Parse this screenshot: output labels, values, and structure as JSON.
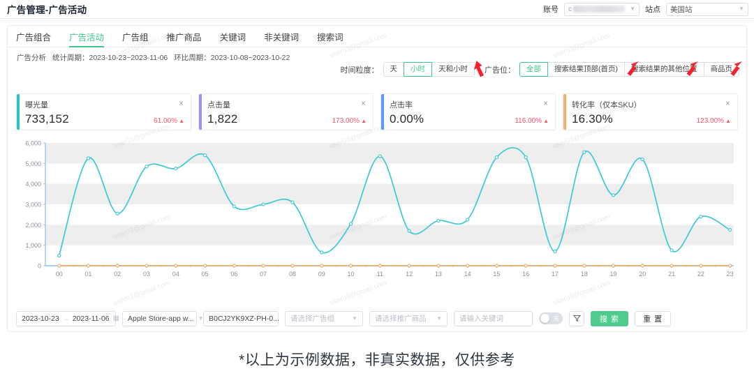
{
  "topbar": {
    "page_title": "广告管理-广告活动",
    "account_label": "账号",
    "account_value": "",
    "site_label": "站点",
    "site_value": "美国站"
  },
  "tabs": [
    {
      "label": "广告组合",
      "active": false
    },
    {
      "label": "广告活动",
      "active": true
    },
    {
      "label": "广告组",
      "active": false
    },
    {
      "label": "推广商品",
      "active": false
    },
    {
      "label": "关键词",
      "active": false
    },
    {
      "label": "非关键词",
      "active": false
    },
    {
      "label": "搜索词",
      "active": false
    }
  ],
  "meta": {
    "section": "广告分析",
    "stat_period": "统计周期：2023-10-23~2023-11-06",
    "compare_period": "环比周期：2023-10-08~2023-10-22"
  },
  "granularity": {
    "label": "时间粒度：",
    "options": [
      {
        "label": "天",
        "active": false
      },
      {
        "label": "小时",
        "active": true
      },
      {
        "label": "天和小时",
        "active": false
      }
    ]
  },
  "placement": {
    "label": "广告位：",
    "options": [
      {
        "label": "全部",
        "active": true
      },
      {
        "label": "搜索结果顶部(首页)",
        "active": false
      },
      {
        "label": "搜索结果的其他位置",
        "active": false
      },
      {
        "label": "商品页",
        "active": false
      }
    ]
  },
  "cards": [
    {
      "title": "曝光量",
      "value": "733,152",
      "delta": "61.00%",
      "trend": "up",
      "accent": "#2bc4c4",
      "close": "×"
    },
    {
      "title": "点击量",
      "value": "1,822",
      "delta": "173.00%",
      "trend": "up",
      "accent": "#a78bfa",
      "close": "×"
    },
    {
      "title": "点击率",
      "value": "0.00%",
      "delta": "116.00%",
      "trend": "up",
      "accent": "#5b9bf8",
      "close": "×"
    },
    {
      "title": "转化率（仅本SKU）",
      "value": "16.30%",
      "delta": "123.00%",
      "trend": "up",
      "accent": "#f7b26a",
      "close": "×"
    }
  ],
  "chart_data": {
    "type": "line",
    "title": "",
    "xlabel": "",
    "ylabel": "",
    "x": [
      "00",
      "01",
      "02",
      "03",
      "04",
      "05",
      "06",
      "07",
      "08",
      "09",
      "10",
      "11",
      "12",
      "13",
      "14",
      "15",
      "16",
      "17",
      "18",
      "19",
      "20",
      "21",
      "22",
      "23"
    ],
    "ylim": [
      0,
      6000
    ],
    "yticks": [
      0,
      1000,
      2000,
      3000,
      4000,
      5000,
      6000
    ],
    "ytick_labels": [
      "0",
      "1,000",
      "2,000",
      "3,000",
      "4,000",
      "5,000",
      "6,000"
    ],
    "grid": "alternating-bands",
    "legend": "none",
    "series": [
      {
        "name": "曝光量",
        "color": "#3bc9d4",
        "values": [
          500,
          5250,
          2550,
          4850,
          4750,
          5400,
          2900,
          3000,
          3100,
          650,
          2050,
          5350,
          1700,
          2200,
          2250,
          5300,
          5300,
          700,
          5550,
          3450,
          5200,
          750,
          2400,
          1750
        ]
      },
      {
        "name": "点击量",
        "color": "#f0a868",
        "values": [
          0,
          0,
          0,
          0,
          0,
          0,
          0,
          0,
          0,
          0,
          0,
          0,
          0,
          0,
          0,
          0,
          0,
          0,
          0,
          0,
          0,
          0,
          0,
          0
        ]
      }
    ]
  },
  "filterbar": {
    "date_start": "2023-10-23",
    "date_arrow": "→",
    "date_end": "2023-11-06",
    "app_value": "Apple Store-app w...",
    "sku_value": "B0CJ2YK9XZ-PH-0...",
    "group_placeholder": "请选择广告组",
    "product_placeholder": "请选择推广商品",
    "keyword_placeholder": "请输入关键词",
    "toggle_label": "关",
    "search_label": "搜 索",
    "reset_label": "重 置"
  },
  "footer_note": "*以上为示例数据，非真实数据，仅供参考",
  "watermark_text": "user03@gmail.com",
  "colors": {
    "accent_green": "#3ec98a",
    "search_green": "#4ecb8d",
    "delta_red": "#f5536b",
    "arrow_red": "#f5222d",
    "line_teal": "#3bc9d4",
    "line_orange": "#f0a868"
  }
}
